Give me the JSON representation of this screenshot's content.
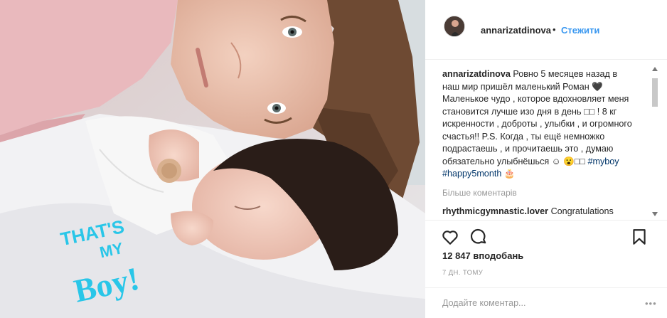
{
  "post": {
    "username": "annarizatdinova",
    "separator": "•",
    "follow_label": "Стежити",
    "caption_user": "annarizatdinova",
    "caption_text": "Ровно 5 месяцев назад в наш мир пришёл маленький Роман 🖤 Маленькое чудо , которое вдохновляет меня становится лучше изо дня в день □□ ! 8 кг искренности , доброты , улыбки , и огромного счастья!! P.S. Когда , ты ещё немножко подрастаешь , и прочитаешь это , думаю обязательно улыбнёшься ☺ 😮□□",
    "hashtag1": "#myboy",
    "hashtag2": "#happy5month",
    "cake_emoji": "🎂",
    "more_comments": "Більше коментарів",
    "comment_user": "rhythmicgymnastic.lover",
    "comment_text": "Congratulations",
    "likes": "12 847 вподобань",
    "time": "7 ДН. ТОМУ",
    "add_comment_placeholder": "Додайте коментар...",
    "add_comment_more": "•••"
  },
  "sticker": {
    "line1": "THAT'S",
    "line2": "MY",
    "line3": "Boy!"
  },
  "icons": {
    "like": "heart-icon",
    "comment": "speech-bubble-icon",
    "save": "bookmark-icon"
  },
  "colors": {
    "link": "#3897f0",
    "hashtag": "#003569",
    "sticker": "#29c6e8",
    "muted": "#999999"
  }
}
